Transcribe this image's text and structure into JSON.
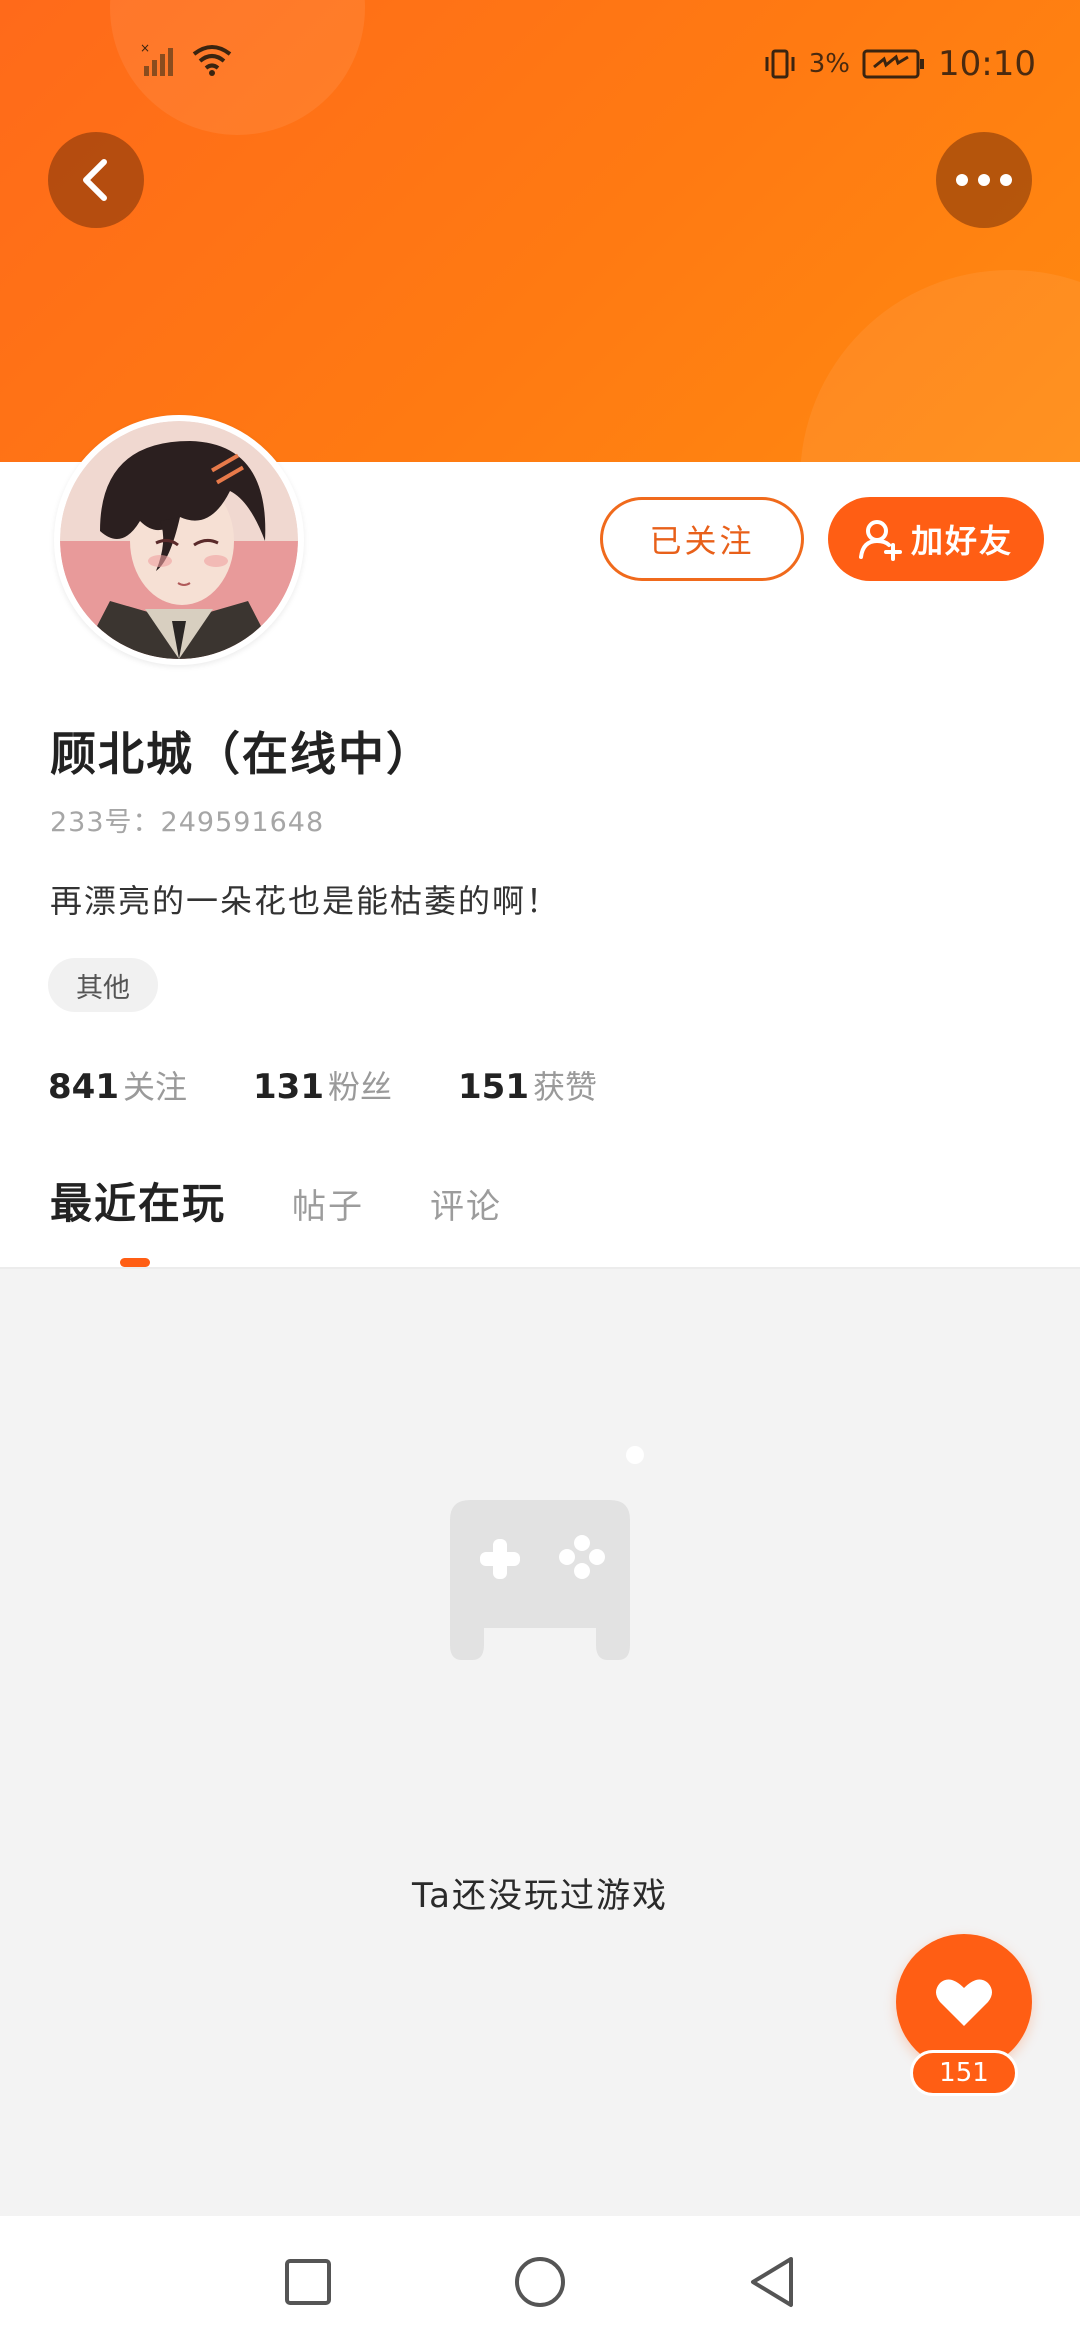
{
  "status_bar": {
    "battery_percent": "3%",
    "time": "10:10"
  },
  "header": {
    "accent": "#ff6a1a"
  },
  "profile": {
    "name": "顾北城（在线中）",
    "id_label": "233号：249591648",
    "bio": "再漂亮的一朵花也是能枯萎的啊！",
    "tag": "其他",
    "follow_button": "已关注",
    "add_friend_button": "加好友"
  },
  "stats": [
    {
      "num": "841",
      "label": "关注"
    },
    {
      "num": "131",
      "label": "粉丝"
    },
    {
      "num": "151",
      "label": "获赞"
    }
  ],
  "tabs": [
    {
      "label": "最近在玩",
      "active": true
    },
    {
      "label": "帖子",
      "active": false
    },
    {
      "label": "评论",
      "active": false
    }
  ],
  "empty_state": {
    "text": "Ta还没玩过游戏"
  },
  "like": {
    "count": "151"
  },
  "colors": {
    "primary": "#ff5e14",
    "background": "#f3f3f3"
  }
}
